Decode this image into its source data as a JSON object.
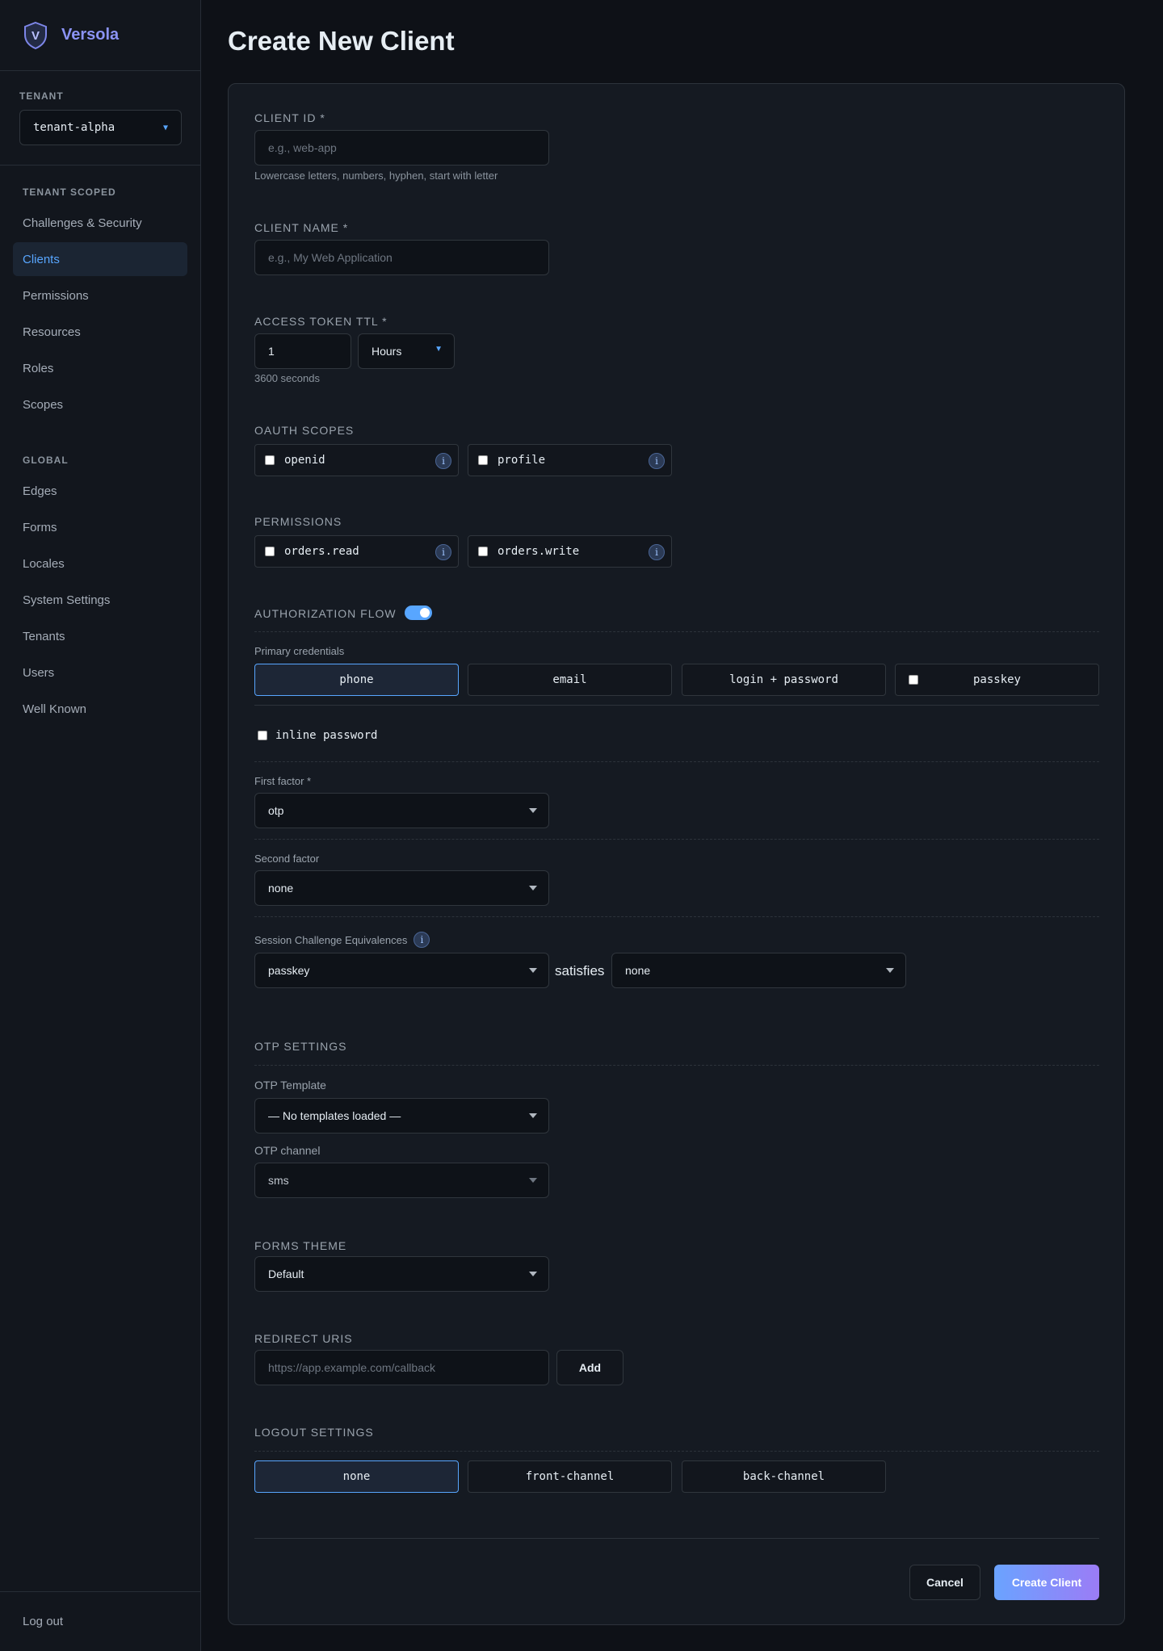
{
  "brand": {
    "name": "Versola",
    "logo_letter": "V"
  },
  "tenant": {
    "caption": "TENANT",
    "selected": "tenant-alpha"
  },
  "nav": {
    "tenant_scoped_caption": "TENANT SCOPED",
    "tenant_scoped_items": [
      "Challenges & Security",
      "Clients",
      "Permissions",
      "Resources",
      "Roles",
      "Scopes"
    ],
    "active_item": "Clients",
    "global_caption": "GLOBAL",
    "global_items": [
      "Edges",
      "Forms",
      "Locales",
      "System Settings",
      "Tenants",
      "Users",
      "Well Known"
    ],
    "logout": "Log out"
  },
  "page": {
    "title": "Create New Client"
  },
  "form": {
    "client_id": {
      "label": "CLIENT ID *",
      "placeholder": "e.g., web-app",
      "hint": "Lowercase letters, numbers, hyphen, start with letter"
    },
    "client_name": {
      "label": "CLIENT NAME *",
      "placeholder": "e.g., My Web Application"
    },
    "ttl": {
      "label": "ACCESS TOKEN TTL *",
      "value": "1",
      "unit": "Hours",
      "hint": "3600 seconds"
    },
    "oauth_scopes": {
      "label": "OAUTH SCOPES",
      "items": [
        "openid",
        "profile"
      ]
    },
    "permissions": {
      "label": "PERMISSIONS",
      "items": [
        "orders.read",
        "orders.write"
      ]
    },
    "auth_flow": {
      "label": "AUTHORIZATION FLOW",
      "enabled": true,
      "primary_label": "Primary credentials",
      "primary_options": [
        "phone",
        "email",
        "login + password",
        "passkey"
      ],
      "primary_selected": "phone",
      "inline_password": "inline password",
      "first_factor_label": "First factor *",
      "first_factor": "otp",
      "second_factor_label": "Second factor",
      "second_factor": "none",
      "equiv_label": "Session Challenge Equivalences",
      "equiv_left": "passkey",
      "equiv_mid": "satisfies",
      "equiv_right": "none"
    },
    "otp": {
      "label": "OTP SETTINGS",
      "template_label": "OTP Template",
      "template": "— No templates loaded —",
      "channel_label": "OTP channel",
      "channel": "sms"
    },
    "forms_theme": {
      "label": "FORMS THEME",
      "value": "Default"
    },
    "redirect": {
      "label": "REDIRECT URIS",
      "placeholder": "https://app.example.com/callback",
      "add_label": "Add"
    },
    "logout": {
      "label": "LOGOUT SETTINGS",
      "options": [
        "none",
        "front-channel",
        "back-channel"
      ],
      "selected": "none"
    },
    "actions": {
      "cancel": "Cancel",
      "create": "Create Client"
    }
  },
  "colors": {
    "accent": "#58a6ff",
    "brand": "#8b93f5",
    "background": "#0e1117"
  }
}
